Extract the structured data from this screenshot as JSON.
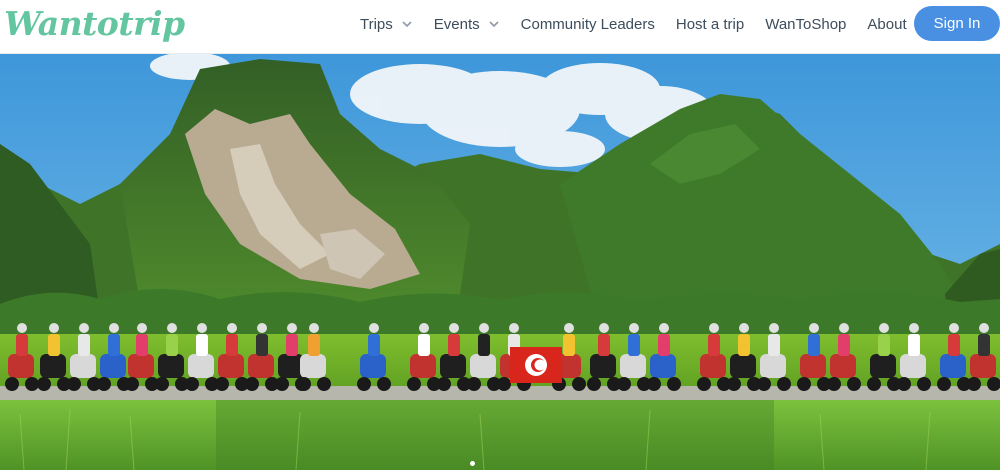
{
  "brand": {
    "logo_text": "Wantotrip",
    "logo_color": "#63c6a0"
  },
  "nav": {
    "items": [
      {
        "label": "Trips",
        "has_dropdown": true
      },
      {
        "label": "Events",
        "has_dropdown": true
      },
      {
        "label": "Community Leaders",
        "has_dropdown": false
      },
      {
        "label": "Host a trip",
        "has_dropdown": false
      },
      {
        "label": "WanToShop",
        "has_dropdown": false
      },
      {
        "label": "About",
        "has_dropdown": true
      }
    ],
    "signin_label": "Sign In",
    "signin_color": "#4a90e2"
  },
  "hero": {
    "image_subject": "group of motorbike riders lined up on a road in front of green karst mountains and rice fields",
    "carousel_dots": 1,
    "active_dot": 1
  }
}
